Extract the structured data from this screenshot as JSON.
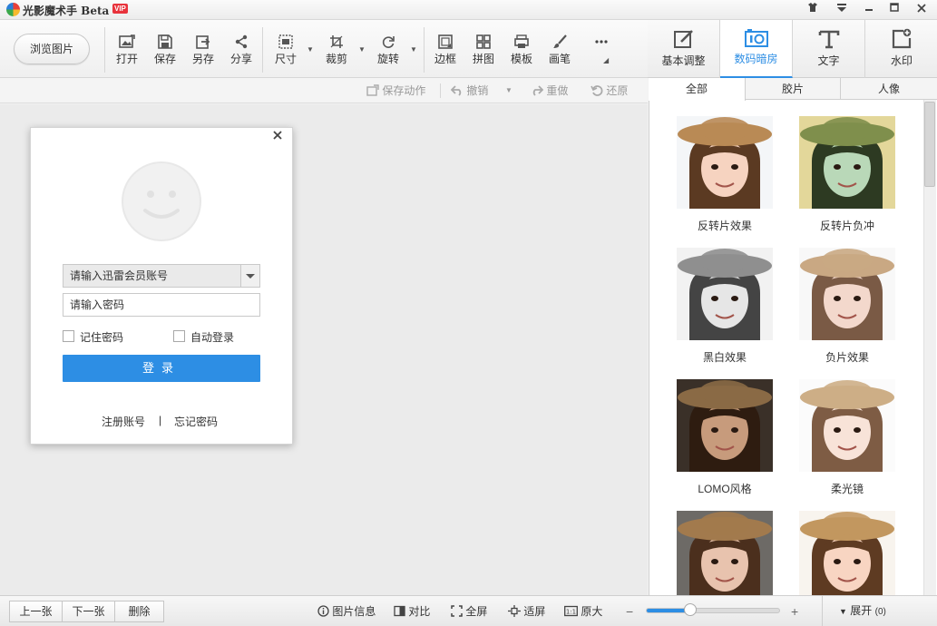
{
  "app": {
    "title": "光影魔术手 Beta",
    "badge": "VIP"
  },
  "toolbar": {
    "browse": "浏览图片",
    "tools": [
      {
        "label": "打开",
        "icon": "open-image-icon"
      },
      {
        "label": "保存",
        "icon": "save-icon"
      },
      {
        "label": "另存",
        "icon": "save-as-icon"
      },
      {
        "label": "分享",
        "icon": "share-icon"
      },
      {
        "label": "尺寸",
        "icon": "resize-icon"
      },
      {
        "label": "裁剪",
        "icon": "crop-icon"
      },
      {
        "label": "旋转",
        "icon": "rotate-icon"
      },
      {
        "label": "边框",
        "icon": "border-icon"
      },
      {
        "label": "拼图",
        "icon": "collage-icon"
      },
      {
        "label": "模板",
        "icon": "template-icon"
      },
      {
        "label": "画笔",
        "icon": "brush-icon"
      },
      {
        "label": "",
        "icon": "more-icon"
      }
    ]
  },
  "righttabs": [
    {
      "label": "基本调整",
      "icon": "edit-icon"
    },
    {
      "label": "数码暗房",
      "icon": "darkroom-icon"
    },
    {
      "label": "文字",
      "icon": "text-icon"
    },
    {
      "label": "水印",
      "icon": "watermark-icon"
    }
  ],
  "actions": {
    "save_action": "保存动作",
    "undo": "撤销",
    "redo": "重做",
    "restore": "还原"
  },
  "sub_tabs": [
    "全部",
    "胶片",
    "人像"
  ],
  "effects": [
    "反转片效果",
    "反转片负冲",
    "黑白效果",
    "负片效果",
    "LOMO风格",
    "柔光镜",
    "",
    ""
  ],
  "login": {
    "account_placeholder": "请输入迅雷会员账号",
    "password_placeholder": "请输入密码",
    "remember": "记住密码",
    "auto_login": "自动登录",
    "login_button": "登录",
    "register": "注册账号",
    "divider": "|",
    "forgot": "忘记密码"
  },
  "status": {
    "prev": "上一张",
    "next": "下一张",
    "delete": "删除",
    "info": "图片信息",
    "compare": "对比",
    "fullscreen": "全屏",
    "fit": "适屏",
    "original": "原大",
    "zoom_minus": "−",
    "zoom_plus": "+",
    "zoom_level": 0.33,
    "expand": "展开",
    "expand_count": "(0)"
  }
}
